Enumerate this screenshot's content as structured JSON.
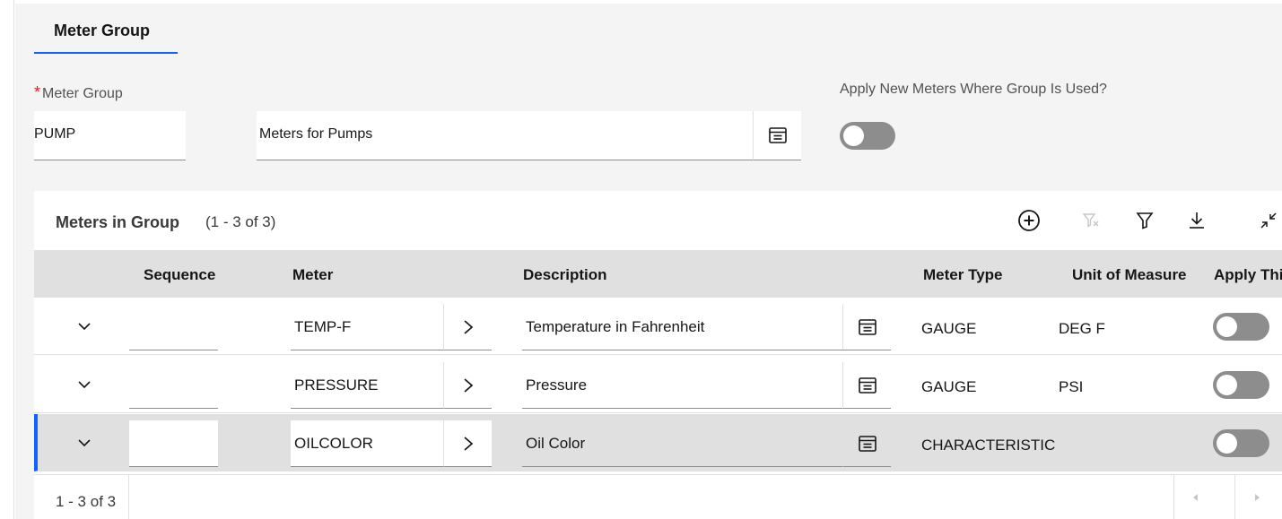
{
  "tab": {
    "label": "Meter Group"
  },
  "form": {
    "required_mark": "*",
    "meter_group_label": "Meter Group",
    "meter_group_value": "PUMP",
    "description_value": "Meters for Pumps",
    "apply_label": "Apply New Meters Where Group Is Used?",
    "apply_toggle": "off"
  },
  "panel": {
    "title": "Meters in Group",
    "count": "(1 - 3 of 3)",
    "toolbar_icons": [
      "add-icon",
      "clear-filter-icon",
      "filter-icon",
      "download-icon",
      "collapse-icon"
    ]
  },
  "table": {
    "headers": {
      "sequence": "Sequence",
      "meter": "Meter",
      "description": "Description",
      "meter_type": "Meter Type",
      "unit": "Unit of Measure",
      "apply": "Apply Thi"
    },
    "rows": [
      {
        "sequence": "",
        "meter": "TEMP-F",
        "description": "Temperature in Fahrenheit",
        "meter_type": "GAUGE",
        "unit": "DEG F",
        "apply": "off"
      },
      {
        "sequence": "",
        "meter": "PRESSURE",
        "description": "Pressure",
        "meter_type": "GAUGE",
        "unit": "PSI",
        "apply": "off"
      },
      {
        "sequence": "",
        "meter": "OILCOLOR",
        "description": "Oil Color",
        "meter_type": "CHARACTERISTIC",
        "unit": "",
        "apply": "off",
        "selected": true
      }
    ]
  },
  "footer": {
    "pagination": "1 - 3 of 3"
  },
  "colors": {
    "accent": "#0f62fe",
    "required": "#da1e28",
    "toggle_off": "#8d8d8d",
    "header_bg": "#e0e0e0"
  }
}
